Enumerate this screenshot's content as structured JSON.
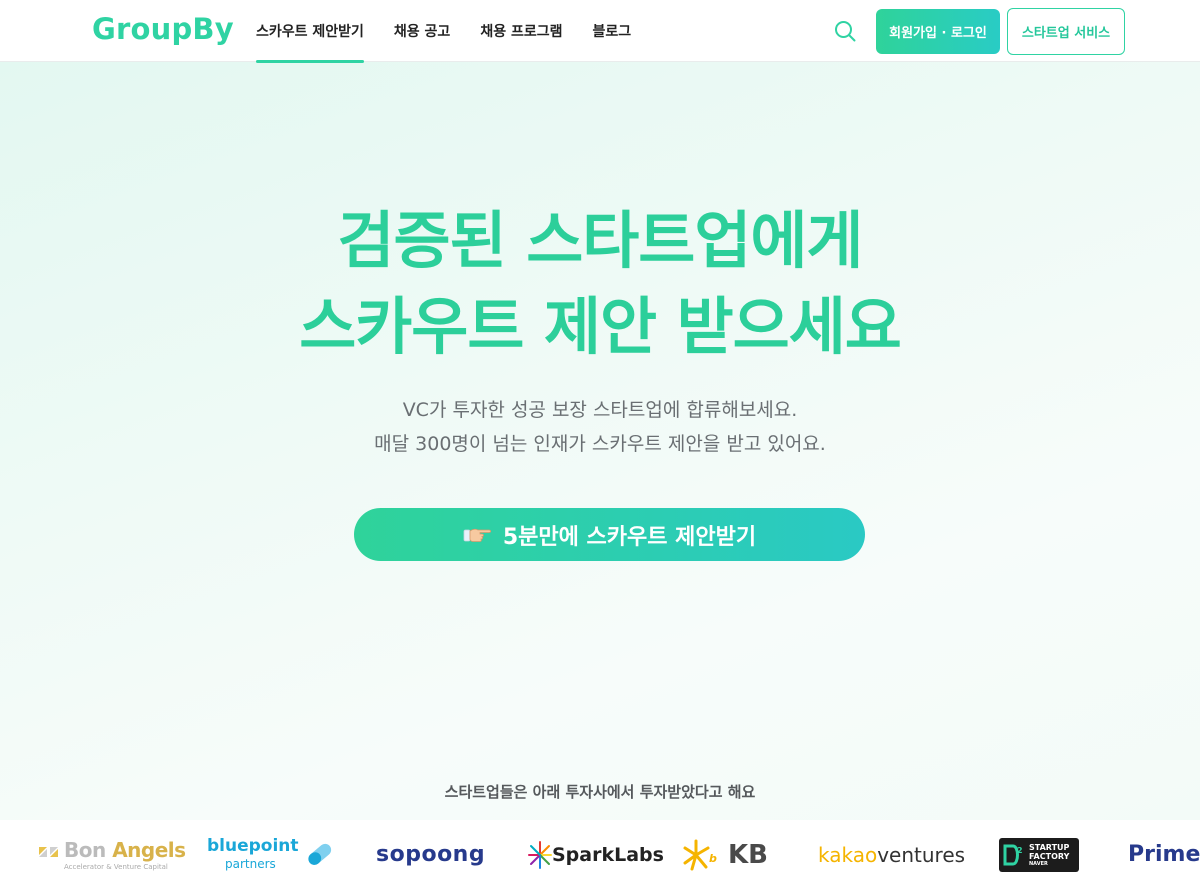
{
  "header": {
    "logo": "GroupBy",
    "nav": [
      {
        "label": "스카우트 제안받기",
        "active": true
      },
      {
        "label": "채용 공고",
        "active": false
      },
      {
        "label": "채용 프로그램",
        "active": false
      },
      {
        "label": "블로그",
        "active": false
      }
    ],
    "search_icon": "search-icon",
    "login_label": "회원가입 · 로그인",
    "startup_label": "스타트업 서비스"
  },
  "hero": {
    "title_line1": "검증된 스타트업에게",
    "title_line2": "스카우트 제안 받으세요",
    "subtitle_line1": "VC가 투자한 성공 보장 스타트업에 합류해보세요.",
    "subtitle_line2": "매달 300명이 넘는 인재가 스카우트 제안을 받고 있어요.",
    "cta_icon": "pointing-hand-icon",
    "cta_label": "5분만에 스카우트 제안받기",
    "investors_caption": "스타트업들은 아래 투자사에서 투자받았다고 해요"
  },
  "investors": {
    "bonangels": {
      "bon": "Bon",
      "angels": "Angels",
      "tagline": "Accelerator & Venture Capital"
    },
    "bluepoint": {
      "name": "bluepoint",
      "tagline": "partners"
    },
    "sopoong": "sopoong",
    "sparklabs": "SparkLabs",
    "kb": "KB",
    "kakao": {
      "part1": "kakao",
      "part2": "ventures"
    },
    "d2sf": {
      "line1": "STARTUP",
      "line2": "FACTORY",
      "line3": "NAVER"
    },
    "primer": "Primer"
  },
  "colors": {
    "brand": "#2fd3a3",
    "brand_gradient_end": "#29ccc5",
    "subtitle_text": "#6a6f73"
  }
}
